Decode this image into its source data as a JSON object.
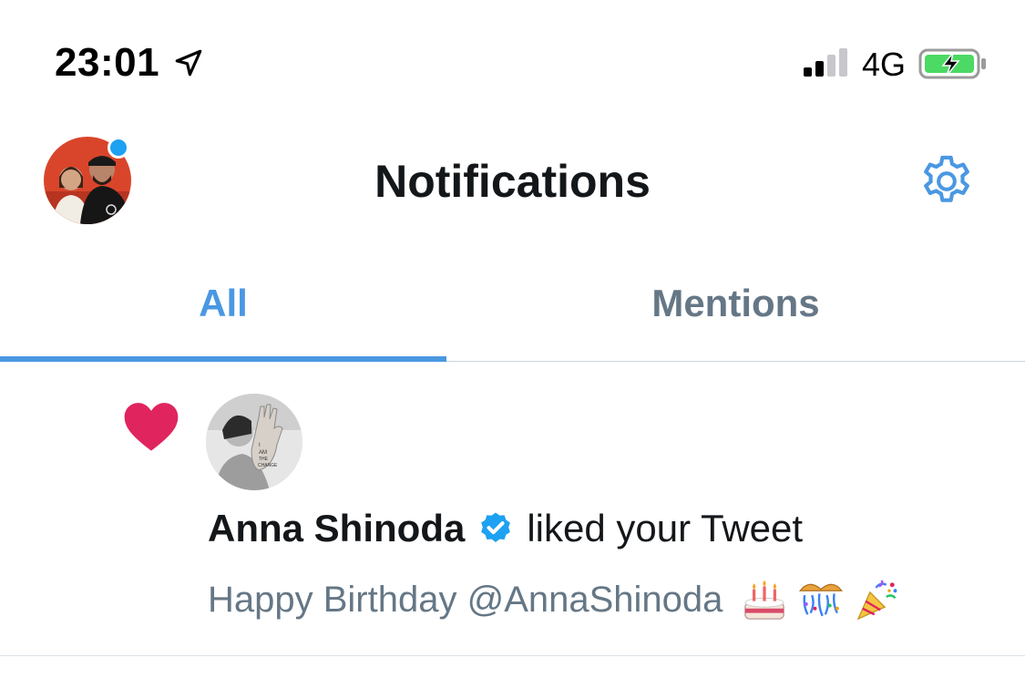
{
  "status_bar": {
    "time": "23:01",
    "network": "4G",
    "location_icon": "location-arrow-icon",
    "signal_icon": "signal-bars-icon",
    "signal_bars_active": 2,
    "signal_bars_total": 4,
    "battery_icon": "battery-charging-icon",
    "battery_level": 0.85,
    "battery_color": "#4cd964"
  },
  "header": {
    "title": "Notifications",
    "avatar_icon": "profile-avatar",
    "settings_icon": "gear-icon",
    "accent_color": "#4a98e2"
  },
  "tabs": [
    {
      "label": "All",
      "active": true
    },
    {
      "label": "Mentions",
      "active": false
    }
  ],
  "notifications": [
    {
      "type_icon": "heart-icon",
      "heart_color": "#e0245e",
      "user": "Anna Shinoda",
      "verified": true,
      "action": "liked your Tweet",
      "tweet_text": "Happy Birthday @AnnaShinoda",
      "emojis": [
        "birthday-cake-icon",
        "confetti-ball-icon",
        "party-popper-icon"
      ]
    }
  ]
}
